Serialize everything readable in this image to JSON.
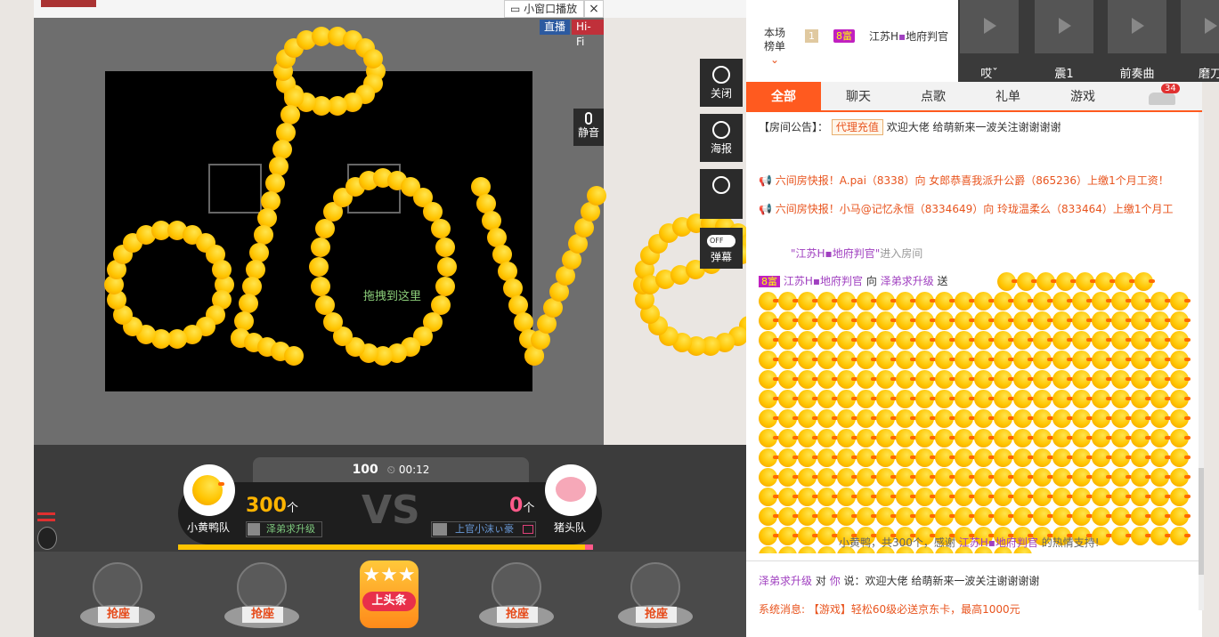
{
  "header": {
    "mini_player": "小窗口播放",
    "close": "×"
  },
  "stage": {
    "live_badge": "直播",
    "hifi_badge": "Hi-Fi",
    "mute_label": "静音",
    "drag_hint": "拖拽到这里"
  },
  "side_tools": {
    "close_label": "关闭",
    "poster_label": "海报",
    "danmaku_label": "弹幕",
    "danmaku_toggle": "OFF"
  },
  "pk": {
    "score_left": "100",
    "timer": "00:12",
    "left_team": "小黄鸭队",
    "right_team": "猪头队",
    "left_count": "300",
    "left_unit": "个",
    "right_count": "0",
    "right_unit": "个",
    "vs": "VS",
    "left_user": "泽弟求升级",
    "right_user": "上官小沫ぃ豪",
    "left_progress": 0.98
  },
  "seats": {
    "grab_label": "抢座",
    "headline_label": "上头条"
  },
  "thumbs": [
    {
      "label": "哎ˇ"
    },
    {
      "label": "震1"
    },
    {
      "label": "前奏曲"
    },
    {
      "label": "磨刀"
    }
  ],
  "rank": {
    "title_line1": "本场",
    "title_line2": "榜单",
    "rank_no": "1",
    "level_badge": "8富",
    "user": "江苏H",
    "user2": "地府判官"
  },
  "tabs": [
    {
      "label": "全部"
    },
    {
      "label": "聊天"
    },
    {
      "label": "点歌"
    },
    {
      "label": "礼单"
    },
    {
      "label": "游戏"
    }
  ],
  "car_count": "34",
  "announcement": {
    "prefix": "【房间公告】：",
    "agent": "代理充值",
    "text": "欢迎大佬 给萌新来一波关注谢谢谢谢"
  },
  "messages": [
    {
      "text": "六间房快报！A.pai（8338）向 女郎恭喜我派升公爵（865236）上缴1个月工资！"
    },
    {
      "text": "六间房快报！小马@记忆永恒（8334649）向 玲珑温柔么（833464）上缴1个月工"
    }
  ],
  "enter": {
    "user": "\"江苏H",
    "user2": "地府判官\"",
    "suffix": "进入房间"
  },
  "gift": {
    "level": "8富",
    "from": "江苏H",
    "from2": "地府判官",
    "to_word": "向",
    "to": "泽弟求升级",
    "send_word": "送",
    "summary_prefix": "小黄鸭，共300个，感谢",
    "summary_user": "江苏H",
    "summary_user2": "地府判官",
    "summary_suffix": "的热情支持!"
  },
  "chat": {
    "user": "泽弟求升级",
    "to_word": "对",
    "target": "你",
    "say": "说：",
    "text": "欢迎大佬 给萌新来一波关注谢谢谢谢"
  },
  "system": {
    "prefix": "系统消息:",
    "text": "【游戏】轻松60级必送京东卡，最高1000元"
  },
  "colors": {
    "accent": "#e8541e",
    "duck": "#ffc400",
    "tab_active": "#ff5a1f"
  }
}
